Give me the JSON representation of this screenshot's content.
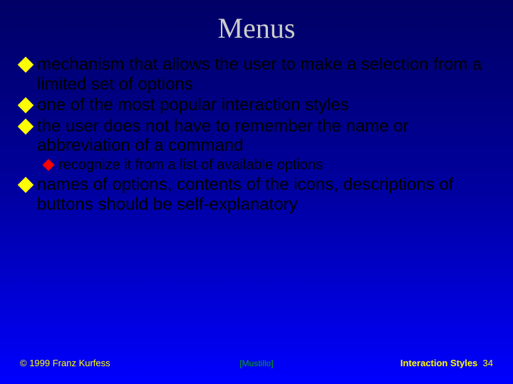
{
  "title": "Menus",
  "bullets": [
    {
      "level": 1,
      "text": "mechanism that allows the user to make a selection from a limited set of options"
    },
    {
      "level": 1,
      "text": "one of the most popular interaction styles"
    },
    {
      "level": 1,
      "text": "the user does not have to remember the name or abbreviation of a command"
    },
    {
      "level": 2,
      "text": "recognize it from a list of available options"
    },
    {
      "level": 1,
      "text": "names of options, contents of the icons, descriptions of  buttons should be self-explanatory"
    }
  ],
  "footer": {
    "copyright": "© 1999 Franz Kurfess",
    "citation": "[Mustillo]",
    "section": "Interaction Styles",
    "page": "34"
  }
}
